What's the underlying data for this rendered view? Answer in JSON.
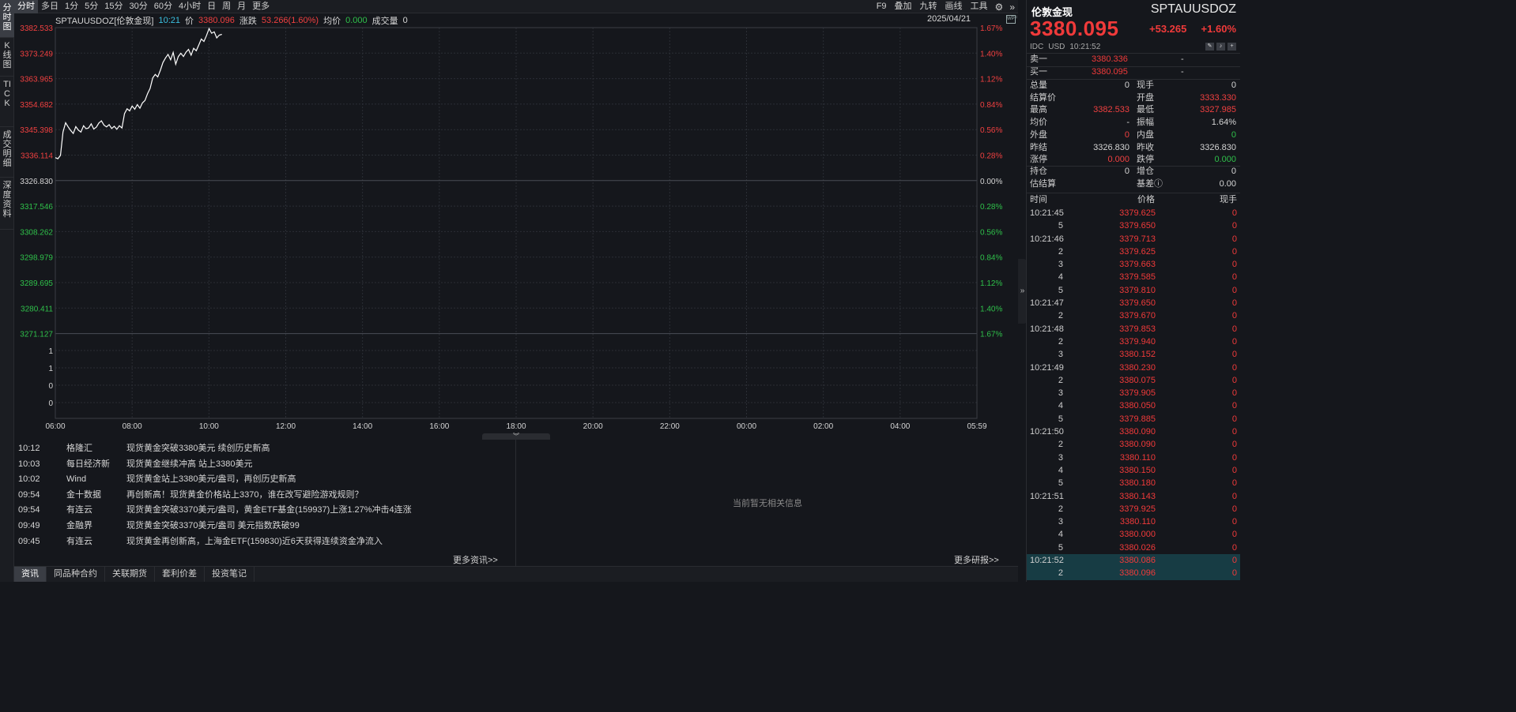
{
  "toolbar": {
    "timeframes": [
      "分时",
      "多日",
      "1分",
      "5分",
      "15分",
      "30分",
      "60分",
      "4小时",
      "日",
      "周",
      "月",
      "更多"
    ],
    "right": [
      "F9",
      "叠加",
      "九转",
      "画线",
      "工具"
    ]
  },
  "left_tabs": [
    "分时图",
    "K线图",
    "TICK",
    "成交明细",
    "深度资料"
  ],
  "chart_header": {
    "symbol": "SPTAUUSDOZ[伦敦金现]",
    "time": "10:21",
    "price_label": "价",
    "price": "3380.096",
    "change_label": "涨跌",
    "change": "53.266(1.60%)",
    "avg_label": "均价",
    "avg": "0.000",
    "volume_label": "成交量",
    "volume": "0",
    "date": "2025/04/21",
    "wpf_icon": "WPF"
  },
  "chart_data": {
    "type": "line",
    "y_left_ticks": [
      "3382.533",
      "3373.249",
      "3363.965",
      "3354.682",
      "3345.398",
      "3336.114",
      "3326.830",
      "3317.546",
      "3308.262",
      "3298.979",
      "3289.695",
      "3280.411",
      "3271.127"
    ],
    "y_right_ticks": [
      "1.67%",
      "1.40%",
      "1.12%",
      "0.84%",
      "0.56%",
      "0.28%",
      "0.00%",
      "0.28%",
      "0.56%",
      "0.84%",
      "1.12%",
      "1.40%",
      "1.67%"
    ],
    "volume_ticks": [
      "1",
      "1",
      "0",
      "0"
    ],
    "x_ticks": [
      "06:00",
      "08:00",
      "10:00",
      "12:00",
      "14:00",
      "16:00",
      "18:00",
      "20:00",
      "22:00",
      "00:00",
      "02:00",
      "04:00",
      "05:59"
    ],
    "ylim": [
      3271.127,
      3382.533
    ],
    "base": 3326.83,
    "x_start_min": 0,
    "x_end_min": 1439,
    "series": [
      {
        "x": [
          0,
          4,
          8,
          12,
          16,
          20,
          24,
          28,
          32,
          36,
          40,
          44,
          48,
          52,
          56,
          60,
          64,
          68,
          72,
          76,
          80,
          84,
          88,
          92,
          96,
          100,
          104,
          108,
          112,
          116,
          120,
          124,
          128,
          132,
          136,
          140,
          144,
          148,
          152,
          156,
          160,
          164,
          168,
          172,
          176,
          180,
          184,
          188,
          192,
          196,
          200,
          204,
          208,
          212,
          216,
          220,
          224,
          228,
          232,
          236,
          240,
          244,
          248,
          252,
          256,
          260
        ],
        "values": [
          3335.2,
          3334.8,
          3336.0,
          3344.5,
          3347.9,
          3346.4,
          3345.1,
          3344.0,
          3346.5,
          3345.2,
          3344.5,
          3346.8,
          3345.7,
          3346.0,
          3347.5,
          3345.6,
          3346.3,
          3347.8,
          3348.6,
          3347.0,
          3346.4,
          3347.2,
          3345.8,
          3346.6,
          3345.5,
          3346.8,
          3346.0,
          3351.2,
          3353.0,
          3352.2,
          3354.0,
          3352.8,
          3354.5,
          3353.2,
          3355.1,
          3356.0,
          3358.5,
          3360.4,
          3364.2,
          3365.5,
          3364.6,
          3367.0,
          3369.8,
          3371.5,
          3372.8,
          3370.8,
          3373.5,
          3369.2,
          3372.0,
          3373.2,
          3372.0,
          3373.6,
          3374.6,
          3372.5,
          3375.0,
          3374.1,
          3376.2,
          3378.4,
          3377.5,
          3379.6,
          3382.2,
          3380.5,
          3381.0,
          3378.8,
          3379.8,
          3380.1
        ]
      }
    ],
    "grid": true
  },
  "news": {
    "items": [
      {
        "time": "10:12",
        "source": "格隆汇",
        "title": "现货黄金突破3380美元 续创历史新高"
      },
      {
        "time": "10:03",
        "source": "每日经济新",
        "title": "现货黄金继续冲高 站上3380美元"
      },
      {
        "time": "10:02",
        "source": "Wind",
        "title": "现货黄金站上3380美元/盎司，再创历史新高"
      },
      {
        "time": "09:54",
        "source": "金十数据",
        "title": "再创新高！现货黄金价格站上3370，谁在改写避险游戏规则？"
      },
      {
        "time": "09:54",
        "source": "有连云",
        "title": "现货黄金突破3370美元/盎司，黄金ETF基金(159937)上涨1.27%冲击4连涨"
      },
      {
        "time": "09:49",
        "source": "金融界",
        "title": "现货黄金突破3370美元/盎司 美元指数跌破99"
      },
      {
        "time": "09:45",
        "source": "有连云",
        "title": "现货黄金再创新高，上海金ETF(159830)近6天获得连续资金净流入"
      }
    ],
    "more": "更多资讯>>"
  },
  "research": {
    "empty": "当前暂无相关信息",
    "more": "更多研报>>"
  },
  "bottom_tabs": [
    "资讯",
    "同品种合约",
    "关联期货",
    "套利价差",
    "投资笔记"
  ],
  "quote": {
    "name": "伦敦金现",
    "code": "SPTAUUSDOZ",
    "price": "3380.095",
    "change": "+53.265",
    "change_pct": "+1.60%",
    "exchange": "IDC",
    "currency": "USD",
    "time": "10:21:52",
    "sell": {
      "label": "卖一",
      "price": "3380.336",
      "vol": "-"
    },
    "buy": {
      "label": "买一",
      "price": "3380.095",
      "vol": "-"
    },
    "stats": [
      {
        "l1": "总量",
        "v1": "0",
        "c1": "w",
        "l2": "现手",
        "v2": "0",
        "c2": "w"
      },
      {
        "l1": "结算价",
        "v1": "",
        "c1": "w",
        "l2": "开盘",
        "v2": "3333.330",
        "c2": "r"
      },
      {
        "l1": "最高",
        "v1": "3382.533",
        "c1": "r",
        "l2": "最低",
        "v2": "3327.985",
        "c2": "r"
      },
      {
        "l1": "均价",
        "v1": "-",
        "c1": "w",
        "l2": "振幅",
        "v2": "1.64%",
        "c2": "w"
      },
      {
        "l1": "外盘",
        "v1": "0",
        "c1": "r",
        "l2": "内盘",
        "v2": "0",
        "c2": "g"
      },
      {
        "l1": "昨结",
        "v1": "3326.830",
        "c1": "w",
        "l2": "昨收",
        "v2": "3326.830",
        "c2": "w"
      },
      {
        "l1": "涨停",
        "v1": "0.000",
        "c1": "r",
        "l2": "跌停",
        "v2": "0.000",
        "c2": "g"
      }
    ],
    "stats2": [
      {
        "l1": "持仓",
        "v1": "0",
        "c1": "w",
        "l2": "增仓",
        "v2": "0",
        "c2": "w"
      },
      {
        "l1": "估结算",
        "v1": "",
        "c1": "w",
        "l2": "基差ⓘ",
        "v2": "0.00",
        "c2": "w"
      }
    ]
  },
  "ticks": {
    "header": {
      "time": "时间",
      "price": "价格",
      "vol": "现手"
    },
    "rows": [
      {
        "time": "10:21:45",
        "price": "3379.625",
        "vol": "0",
        "full": true,
        "hl": false
      },
      {
        "time": "5",
        "price": "3379.650",
        "vol": "0",
        "full": false,
        "hl": false
      },
      {
        "time": "10:21:46",
        "price": "3379.713",
        "vol": "0",
        "full": true,
        "hl": false
      },
      {
        "time": "2",
        "price": "3379.625",
        "vol": "0",
        "full": false,
        "hl": false
      },
      {
        "time": "3",
        "price": "3379.663",
        "vol": "0",
        "full": false,
        "hl": false
      },
      {
        "time": "4",
        "price": "3379.585",
        "vol": "0",
        "full": false,
        "hl": false
      },
      {
        "time": "5",
        "price": "3379.810",
        "vol": "0",
        "full": false,
        "hl": false
      },
      {
        "time": "10:21:47",
        "price": "3379.650",
        "vol": "0",
        "full": true,
        "hl": false
      },
      {
        "time": "2",
        "price": "3379.670",
        "vol": "0",
        "full": false,
        "hl": false
      },
      {
        "time": "10:21:48",
        "price": "3379.853",
        "vol": "0",
        "full": true,
        "hl": false
      },
      {
        "time": "2",
        "price": "3379.940",
        "vol": "0",
        "full": false,
        "hl": false
      },
      {
        "time": "3",
        "price": "3380.152",
        "vol": "0",
        "full": false,
        "hl": false
      },
      {
        "time": "10:21:49",
        "price": "3380.230",
        "vol": "0",
        "full": true,
        "hl": false
      },
      {
        "time": "2",
        "price": "3380.075",
        "vol": "0",
        "full": false,
        "hl": false
      },
      {
        "time": "3",
        "price": "3379.905",
        "vol": "0",
        "full": false,
        "hl": false
      },
      {
        "time": "4",
        "price": "3380.050",
        "vol": "0",
        "full": false,
        "hl": false
      },
      {
        "time": "5",
        "price": "3379.885",
        "vol": "0",
        "full": false,
        "hl": false
      },
      {
        "time": "10:21:50",
        "price": "3380.090",
        "vol": "0",
        "full": true,
        "hl": false
      },
      {
        "time": "2",
        "price": "3380.090",
        "vol": "0",
        "full": false,
        "hl": false
      },
      {
        "time": "3",
        "price": "3380.110",
        "vol": "0",
        "full": false,
        "hl": false
      },
      {
        "time": "4",
        "price": "3380.150",
        "vol": "0",
        "full": false,
        "hl": false
      },
      {
        "time": "5",
        "price": "3380.180",
        "vol": "0",
        "full": false,
        "hl": false
      },
      {
        "time": "10:21:51",
        "price": "3380.143",
        "vol": "0",
        "full": true,
        "hl": false
      },
      {
        "time": "2",
        "price": "3379.925",
        "vol": "0",
        "full": false,
        "hl": false
      },
      {
        "time": "3",
        "price": "3380.110",
        "vol": "0",
        "full": false,
        "hl": false
      },
      {
        "time": "4",
        "price": "3380.000",
        "vol": "0",
        "full": false,
        "hl": false
      },
      {
        "time": "5",
        "price": "3380.026",
        "vol": "0",
        "full": false,
        "hl": false
      },
      {
        "time": "10:21:52",
        "price": "3380.086",
        "vol": "0",
        "full": true,
        "hl": true
      },
      {
        "time": "2",
        "price": "3380.096",
        "vol": "0",
        "full": false,
        "hl": true
      }
    ]
  }
}
